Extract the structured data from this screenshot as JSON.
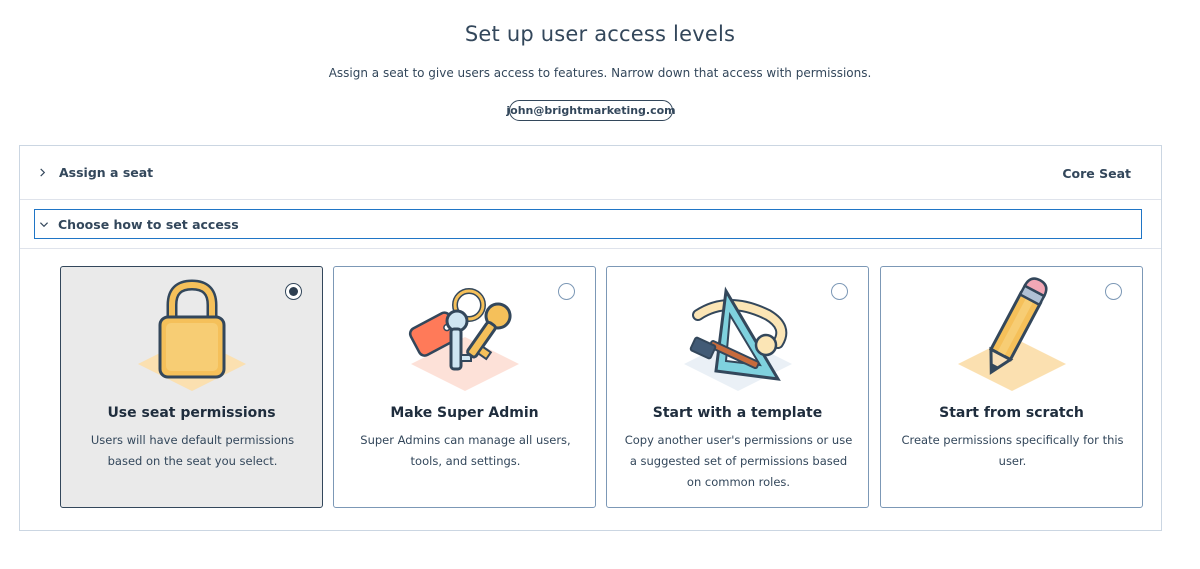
{
  "header": {
    "title": "Set up user access levels",
    "subtitle": "Assign a seat to give users access to features. Narrow down that access with permissions.",
    "email": "john@brightmarketing.com"
  },
  "sections": {
    "seat": {
      "label": "Assign a seat",
      "value": "Core Seat",
      "icon": "chevron-right-icon"
    },
    "access": {
      "label": "Choose how to set access",
      "icon": "chevron-down-icon"
    }
  },
  "options": [
    {
      "title": "Use seat permissions",
      "description": "Users will have default permissions based on the seat you select.",
      "selected": true,
      "icon": "padlock-illustration"
    },
    {
      "title": "Make Super Admin",
      "description": "Super Admins can manage all users, tools, and settings.",
      "selected": false,
      "icon": "keys-illustration"
    },
    {
      "title": "Start with a template",
      "description": "Copy another user's permissions or use a suggested set of permissions based on common roles.",
      "selected": false,
      "icon": "tools-illustration"
    },
    {
      "title": "Start from scratch",
      "description": "Create permissions specifically for this user.",
      "selected": false,
      "icon": "pencil-illustration"
    }
  ],
  "colors": {
    "text": "#33475b",
    "focus_border": "#1f75c6",
    "selected_card_bg": "#eaeaea",
    "illustration_orange": "#f5a623",
    "illustration_coral": "#ff7a59"
  }
}
